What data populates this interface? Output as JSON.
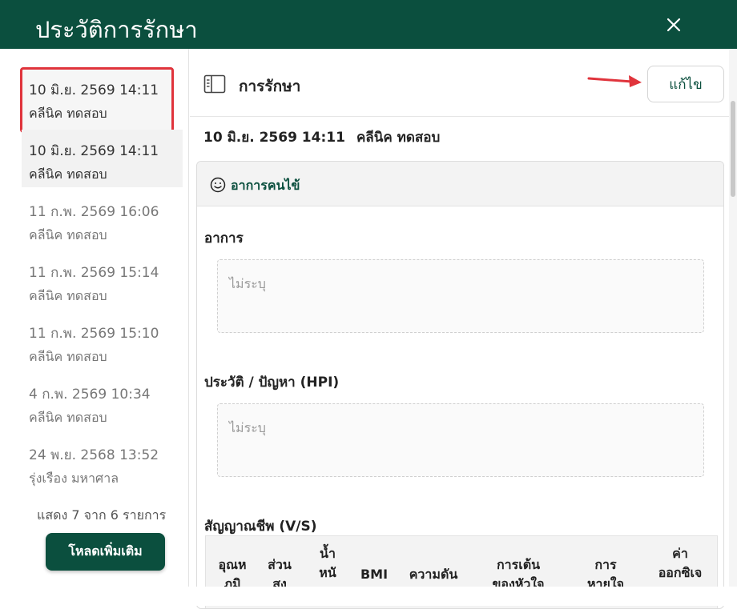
{
  "header": {
    "title": "ประวัติการรักษา",
    "close_icon": "close-icon"
  },
  "sidebar": {
    "items": [
      {
        "date": "10 มิ.ย. 2569 14:11",
        "clinic": "คลีนิค ทดสอบ",
        "state": "highlighted"
      },
      {
        "date": "10 มิ.ย. 2569 14:11",
        "clinic": "คลีนิค ทดสอบ",
        "state": "active"
      },
      {
        "date": "11 ก.พ. 2569 16:06",
        "clinic": "คลีนิค ทดสอบ",
        "state": "normal"
      },
      {
        "date": "11 ก.พ. 2569 15:14",
        "clinic": "คลีนิค ทดสอบ",
        "state": "normal"
      },
      {
        "date": "11 ก.พ. 2569 15:10",
        "clinic": "คลีนิค ทดสอบ",
        "state": "normal"
      },
      {
        "date": "4 ก.พ. 2569 10:34",
        "clinic": "คลีนิค ทดสอบ",
        "state": "normal"
      },
      {
        "date": "24 พ.ย. 2568 13:52",
        "clinic": "รุ่งเรือง มหาศาล",
        "state": "normal"
      }
    ],
    "count_text": "แสดง 7 จาก 6 รายการ",
    "load_more_label": "โหลดเพิ่มเติม"
  },
  "panel": {
    "title": "การรักษา",
    "edit_label": "แก้ไข",
    "visit_date": "10 มิ.ย. 2569 14:11",
    "visit_clinic": "คลีนิค ทดสอบ",
    "section_title": "อาการคนไข้",
    "symptom_label": "อาการ",
    "symptom_value": "ไม่ระบุ",
    "hpi_label": "ประวัติ / ปัญหา (HPI)",
    "hpi_value": "ไม่ระบุ",
    "vitals_label": "สัญญาณชีพ (V/S)",
    "vitals_columns": [
      "อุณห\nภูมิ",
      "ส่วน\nสูง",
      "น้ำ\nหนั",
      "BMI",
      "ความดัน",
      "การเต้น\nของหัวใจ",
      "การ\nหายใจ",
      "ค่า\nออกซิเจ"
    ]
  },
  "colors": {
    "brand": "#0b4f3e",
    "highlight": "#e0343c"
  }
}
